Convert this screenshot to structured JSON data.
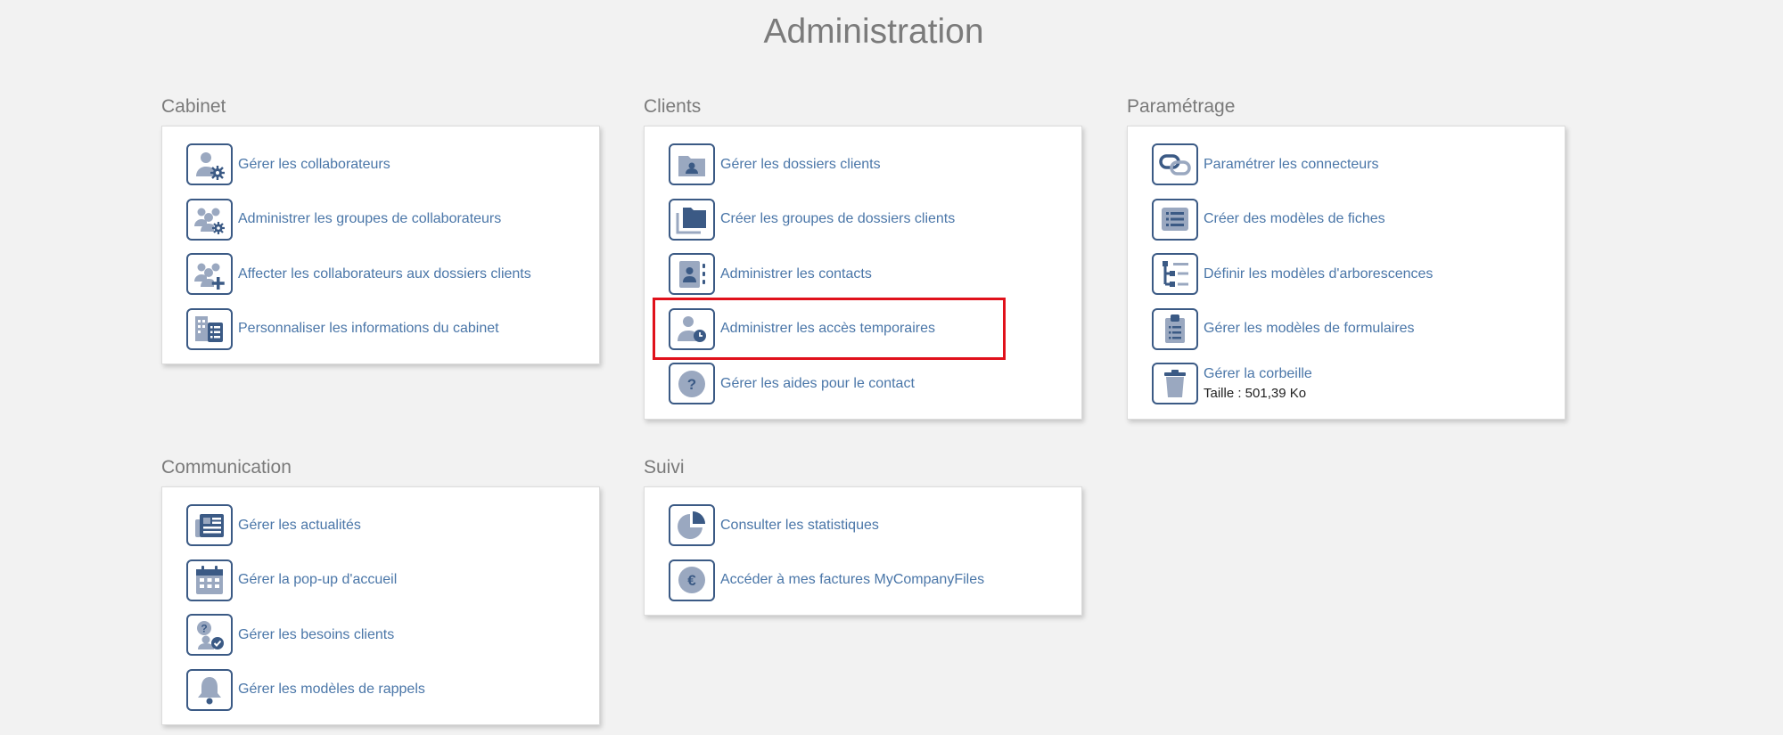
{
  "page": {
    "title": "Administration"
  },
  "sections": {
    "cabinet": {
      "title": "Cabinet",
      "items": [
        {
          "label": "Gérer les collaborateurs",
          "icon": "user-gear-icon"
        },
        {
          "label": "Administrer les groupes de collaborateurs",
          "icon": "users-gear-icon"
        },
        {
          "label": "Affecter les collaborateurs aux dossiers clients",
          "icon": "users-plus-icon"
        },
        {
          "label": "Personnaliser les informations du cabinet",
          "icon": "building-list-icon"
        }
      ]
    },
    "clients": {
      "title": "Clients",
      "items": [
        {
          "label": "Gérer les dossiers clients",
          "icon": "folder-user-icon"
        },
        {
          "label": "Créer les groupes de dossiers clients",
          "icon": "folders-icon"
        },
        {
          "label": "Administrer les contacts",
          "icon": "contact-card-icon"
        },
        {
          "label": "Administrer les accès temporaires",
          "icon": "user-clock-icon"
        },
        {
          "label": "Gérer les aides pour le contact",
          "icon": "question-circle-icon"
        }
      ]
    },
    "parametrage": {
      "title": "Paramétrage",
      "items": [
        {
          "label": "Paramétrer les connecteurs",
          "icon": "link-icon"
        },
        {
          "label": "Créer des modèles de fiches",
          "icon": "list-card-icon"
        },
        {
          "label": "Définir les modèles d'arborescences",
          "icon": "tree-list-icon"
        },
        {
          "label": "Gérer les modèles de formulaires",
          "icon": "clipboard-icon"
        },
        {
          "label": "Gérer la corbeille",
          "sub": "Taille : 501,39 Ko",
          "icon": "trash-icon"
        }
      ]
    },
    "communication": {
      "title": "Communication",
      "items": [
        {
          "label": "Gérer les actualités",
          "icon": "newspaper-icon"
        },
        {
          "label": "Gérer la pop-up d'accueil",
          "icon": "calendar-icon"
        },
        {
          "label": "Gérer les besoins clients",
          "icon": "user-question-icon"
        },
        {
          "label": "Gérer les modèles de rappels",
          "icon": "bell-icon"
        }
      ]
    },
    "suivi": {
      "title": "Suivi",
      "items": [
        {
          "label": "Consulter les statistiques",
          "icon": "pie-chart-icon"
        },
        {
          "label": "Accéder à mes factures MyCompanyFiles",
          "icon": "euro-circle-icon"
        }
      ]
    }
  },
  "colors": {
    "icon_dark": "#3b5a85",
    "icon_light": "#9aa8c0",
    "link": "#4a76a8",
    "highlight": "#e0111b"
  }
}
